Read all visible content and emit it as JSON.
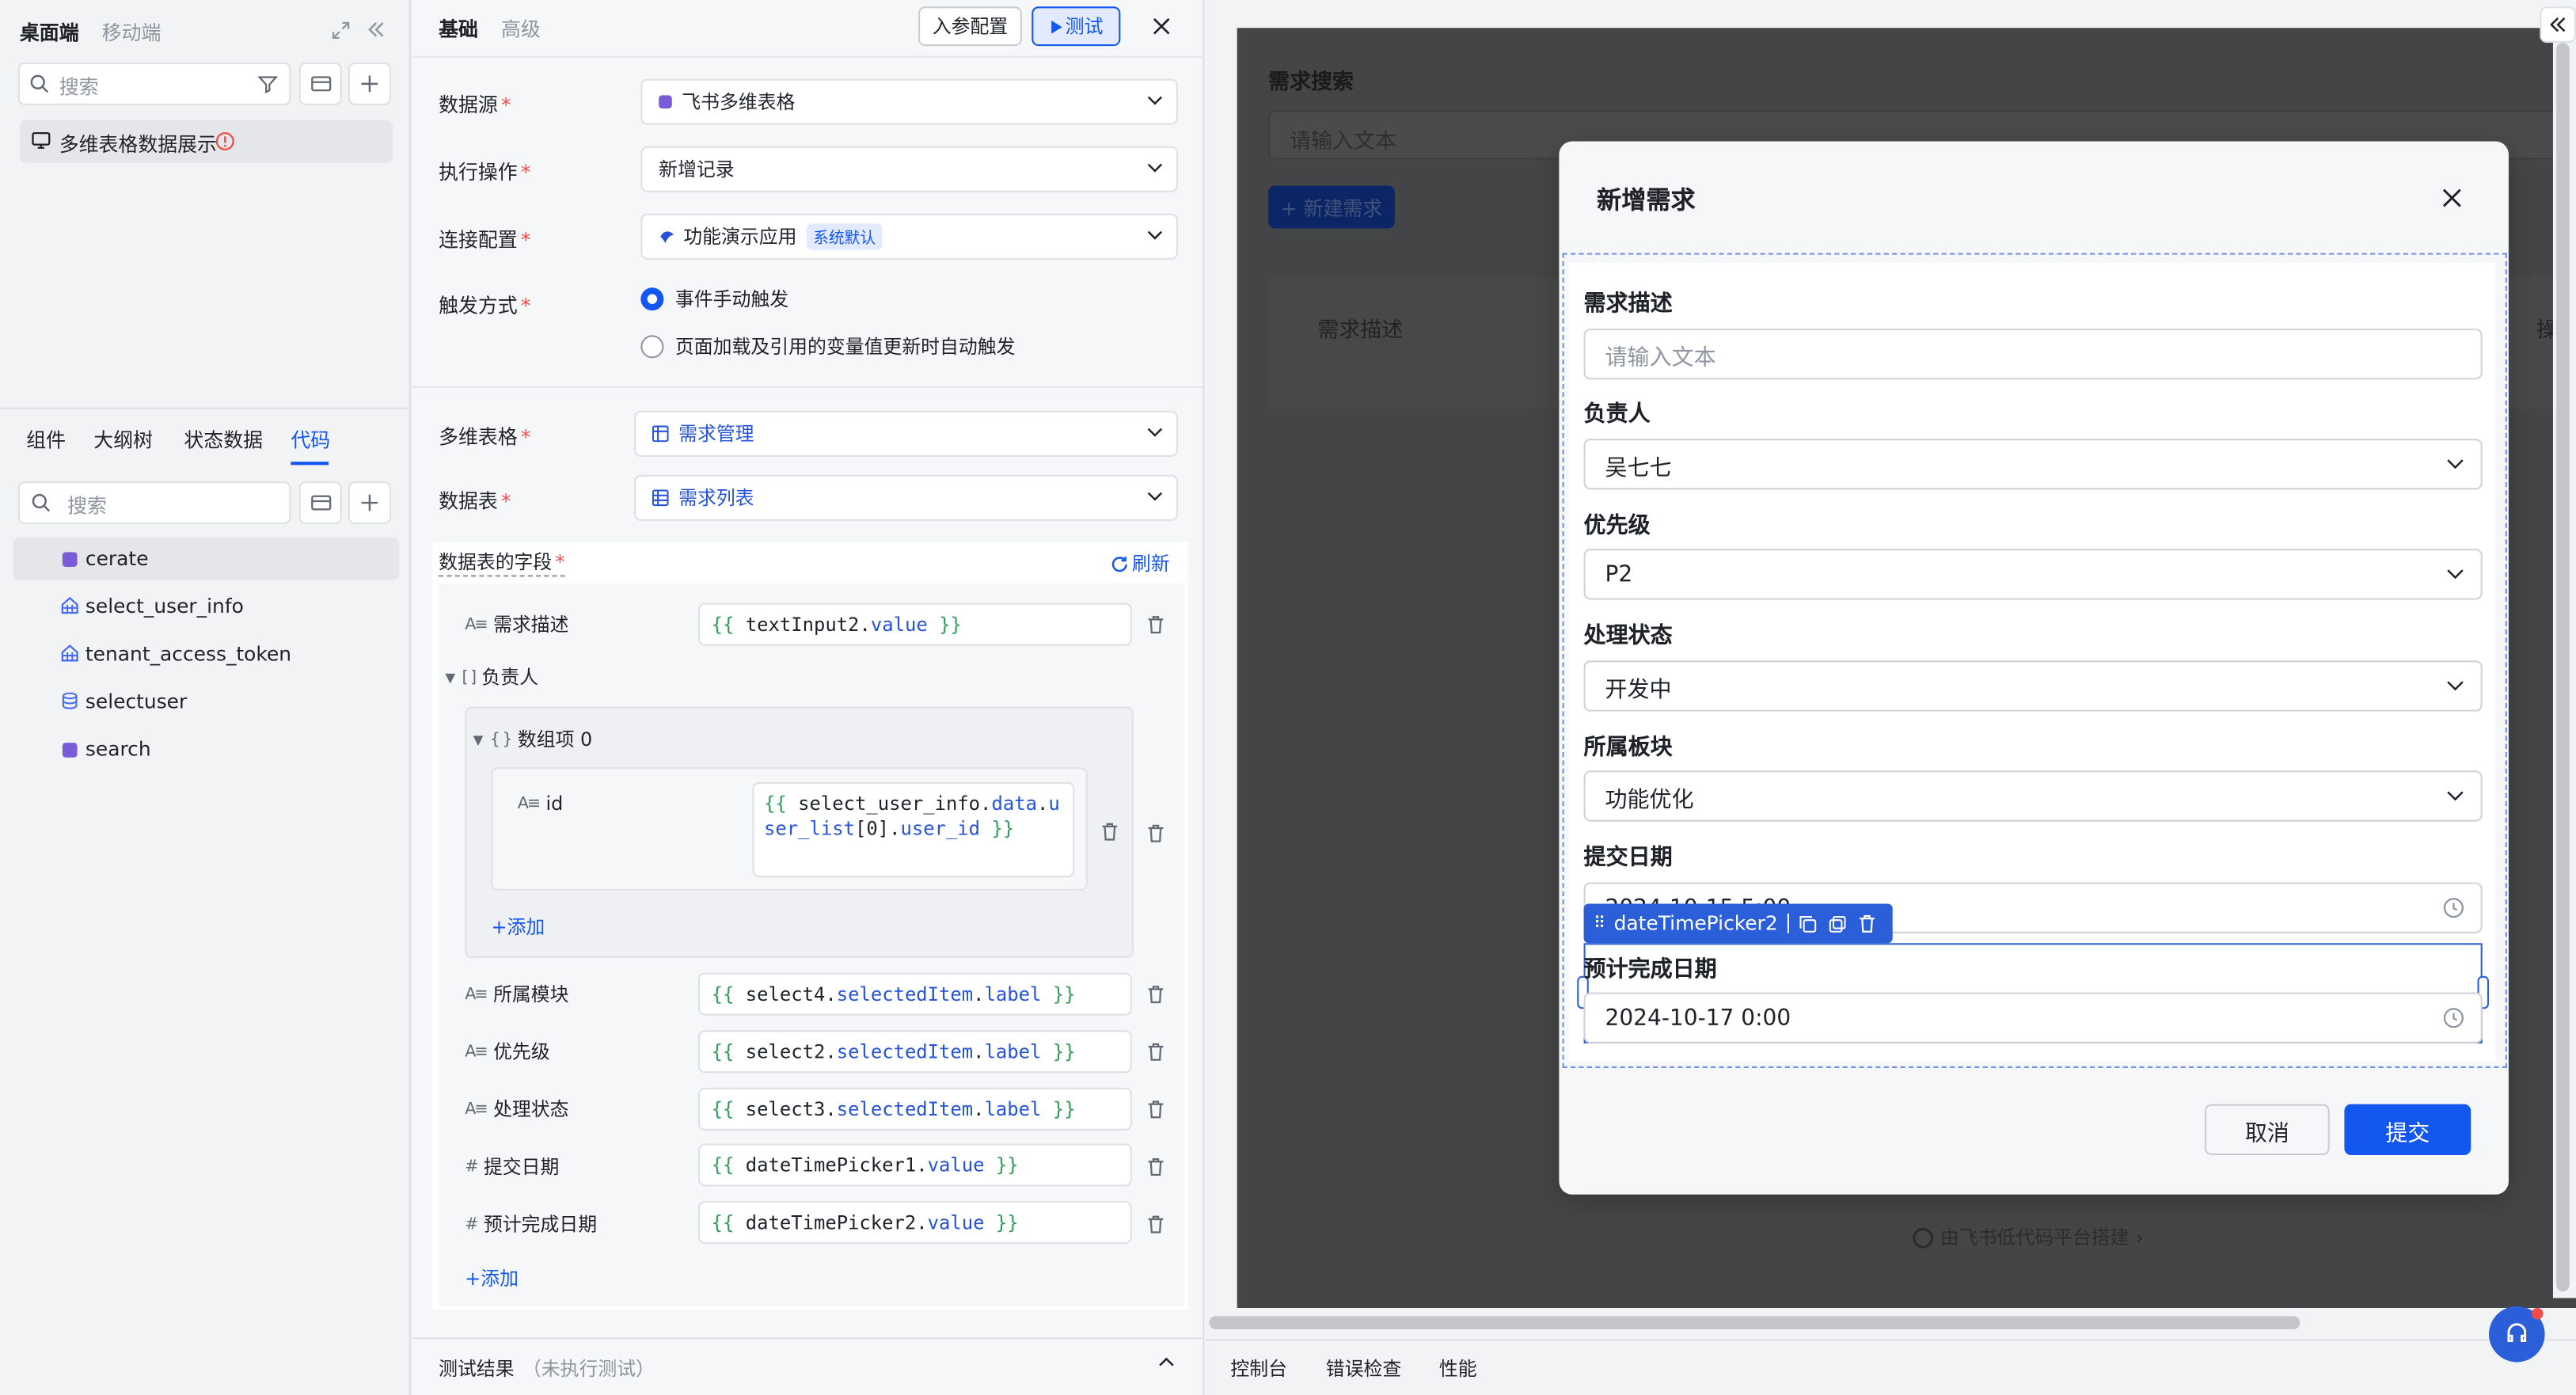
{
  "left_panel": {
    "tabs_top": [
      "桌面端",
      "移动端"
    ],
    "search_placeholder": "搜索",
    "page_item": "多维表格数据展示",
    "tabs_bottom": [
      "组件",
      "大纲树",
      "状态数据",
      "代码"
    ],
    "active_bottom_tab": "代码",
    "search2_placeholder": "搜索",
    "code_items": [
      {
        "label": "cerate",
        "icon": "js-file-icon",
        "color": "#7b5bd8",
        "active": true
      },
      {
        "label": "select_user_info",
        "icon": "api-icon",
        "color": "#4a6cf0",
        "active": false
      },
      {
        "label": "tenant_access_token",
        "icon": "api-icon",
        "color": "#4a6cf0",
        "active": false
      },
      {
        "label": "selectuser",
        "icon": "database-icon",
        "color": "#4a6cf0",
        "active": false
      },
      {
        "label": "search",
        "icon": "js-file-icon",
        "color": "#7b5bd8",
        "active": false
      }
    ]
  },
  "middle_panel": {
    "tabs": [
      "基础",
      "高级"
    ],
    "params_button": "入参配置",
    "test_button": "测试",
    "fields": {
      "datasource_label": "数据源",
      "datasource_value": "飞书多维表格",
      "action_label": "执行操作",
      "action_value": "新增记录",
      "connection_label": "连接配置",
      "connection_value": "功能演示应用",
      "connection_badge": "系统默认",
      "trigger_label": "触发方式",
      "trigger_option1": "事件手动触发",
      "trigger_option2": "页面加载及引用的变量值更新时自动触发",
      "table_label": "多维表格",
      "table_value": "需求管理",
      "sheet_label": "数据表",
      "sheet_value": "需求列表"
    },
    "fields_section": {
      "title": "数据表的字段",
      "refresh": "刷新",
      "rows": [
        {
          "type": "A≡",
          "name": "需求描述",
          "pre": "textInput2",
          "prop": "value"
        },
        {
          "type": "A≡",
          "name": "所属模块",
          "pre": "select4",
          "prop": "selectedItem",
          "prop2": "label"
        },
        {
          "type": "A≡",
          "name": "优先级",
          "pre": "select2",
          "prop": "selectedItem",
          "prop2": "label"
        },
        {
          "type": "A≡",
          "name": "处理状态",
          "pre": "select3",
          "prop": "selectedItem",
          "prop2": "label"
        },
        {
          "type": "#",
          "name": "提交日期",
          "pre": "dateTimePicker1",
          "prop": "value"
        },
        {
          "type": "#",
          "name": "预计完成日期",
          "pre": "dateTimePicker2",
          "prop": "value"
        }
      ],
      "assignee_label": "负责人",
      "array_item_label": "数组项 0",
      "id_label": "id",
      "id_expr_line1": "select_user_info",
      "id_expr_prop1": "data",
      "id_expr_prop2": "data",
      "id_expr_prop3": "user_list",
      "id_expr_idx": "[0]",
      "id_expr_prop4": "user_id",
      "add_inner": "添加",
      "add_outer": "添加"
    },
    "footer": {
      "label": "测试结果",
      "status": "（未执行测试）"
    }
  },
  "preview": {
    "page_title": "需求搜索",
    "search_placeholder": "请输入文本",
    "new_button": "+ 新建需求",
    "table_header": "需求描述",
    "table_header_right": "操",
    "powered_by": "由飞书低代码平台搭建",
    "bottom_tabs": [
      "控制台",
      "错误检查",
      "性能"
    ],
    "modal": {
      "title": "新增需求",
      "desc_label": "需求描述",
      "desc_placeholder": "请输入文本",
      "owner_label": "负责人",
      "owner_value": "吴七七",
      "priority_label": "优先级",
      "priority_value": "P2",
      "status_label": "处理状态",
      "status_value": "开发中",
      "module_label": "所属板块",
      "module_value": "功能优化",
      "submit_date_label": "提交日期",
      "submit_date_value": "2024-10-15 5:00",
      "component_tag": "dateTimePicker2",
      "due_date_label": "预计完成日期",
      "due_date_value": "2024-10-17 0:00",
      "cancel": "取消",
      "submit": "提交"
    }
  }
}
